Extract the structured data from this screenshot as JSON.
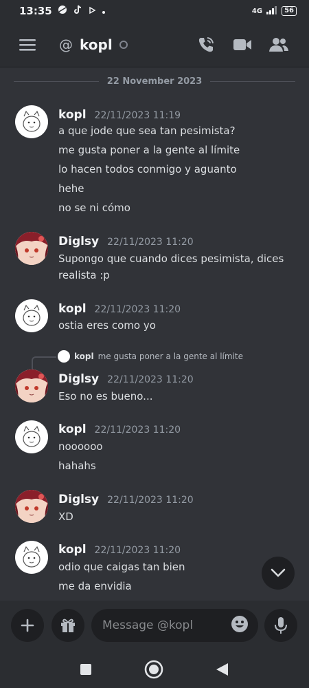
{
  "status_bar": {
    "time": "13:35",
    "network": "4G",
    "battery": "56"
  },
  "header": {
    "at_symbol": "@",
    "channel_name": "kopl"
  },
  "chat": {
    "date_divider": "22 November 2023",
    "messages": [
      {
        "author": "kopl",
        "time": "22/11/2023 11:19",
        "lines": [
          "a que jode que sea tan pesimista?",
          "me gusta poner a la gente al límite",
          "lo hacen todos conmigo y aguanto",
          "hehe",
          "no se ni cómo"
        ]
      },
      {
        "author": "Diglsy",
        "time": "22/11/2023 11:20",
        "lines": [
          "Supongo que cuando dices pesimista, dices",
          "realista :p"
        ]
      },
      {
        "author": "kopl",
        "time": "22/11/2023 11:20",
        "lines": [
          "ostia eres como yo"
        ]
      },
      {
        "author": "Diglsy",
        "time": "22/11/2023 11:20",
        "lines": [
          "Eso no es bueno..."
        ],
        "reply": {
          "author": "kopl",
          "text": "me gusta poner a la gente al límite"
        }
      },
      {
        "author": "kopl",
        "time": "22/11/2023 11:20",
        "lines": [
          "noooooo",
          "hahahs"
        ]
      },
      {
        "author": "Diglsy",
        "time": "22/11/2023 11:20",
        "lines": [
          "XD"
        ]
      },
      {
        "author": "kopl",
        "time": "22/11/2023 11:20",
        "lines": [
          "odio que caigas tan bien",
          "me da envidia"
        ]
      }
    ]
  },
  "composer": {
    "placeholder": "Message @kopl"
  },
  "icons": {
    "menu": "hamburger-menu-icon",
    "call": "phone-call-icon",
    "video": "video-camera-icon",
    "members": "members-icon",
    "add": "plus-icon",
    "gift": "gift-icon",
    "emoji": "emoji-icon",
    "mic": "microphone-icon",
    "scroll": "chevron-down-icon"
  },
  "colors": {
    "background": "#313338",
    "header": "#2b2d31",
    "input": "#1e1f22",
    "text": "#dbdee1",
    "muted": "#949ba4"
  }
}
